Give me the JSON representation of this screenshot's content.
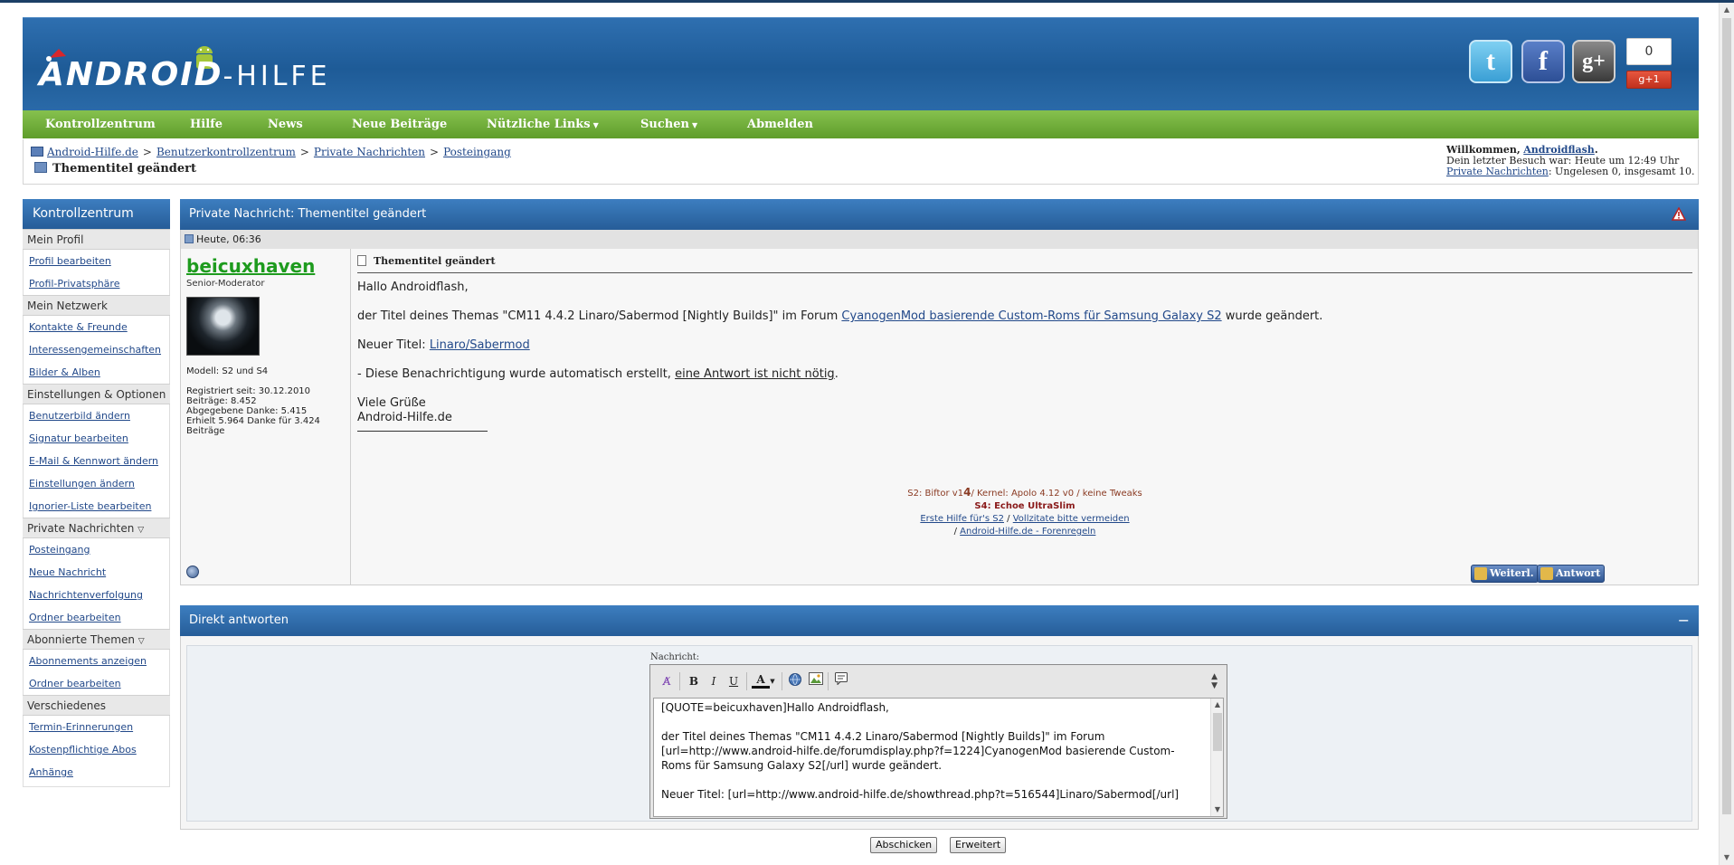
{
  "header": {
    "logo_main": "ANDROID",
    "logo_sub": "-HILFE",
    "gplus_count": "0",
    "gplus_label": "g+1"
  },
  "nav": {
    "items": [
      "Kontrollzentrum",
      "Hilfe",
      "News",
      "Neue Beiträge",
      "Nützliche Links",
      "Suchen",
      "Abmelden"
    ]
  },
  "breadcrumb": {
    "items": [
      "Android-Hilfe.de",
      "Benutzerkontrollzentrum",
      "Private Nachrichten",
      "Posteingang"
    ],
    "separator": ">",
    "current": "Thementitel geändert"
  },
  "welcome": {
    "prefix": "Willkommen,",
    "user": "Androidflash",
    "suffix": ".",
    "last_visit": "Dein letzter Besuch war: Heute um 12:49 Uhr",
    "pm_link": "Private Nachrichten",
    "pm_status": ": Ungelesen 0, insgesamt 10."
  },
  "sidebar": {
    "title": "Kontrollzentrum",
    "groups": [
      {
        "label": "Mein Profil",
        "links": [
          "Profil bearbeiten",
          "Profil-Privatsphäre"
        ]
      },
      {
        "label": "Mein Netzwerk",
        "links": [
          "Kontakte & Freunde",
          "Interessengemeinschaften",
          "Bilder & Alben"
        ]
      },
      {
        "label": "Einstellungen & Optionen",
        "links": [
          "Benutzerbild ändern",
          "Signatur bearbeiten",
          "E-Mail & Kennwort ändern",
          "Einstellungen ändern",
          "Ignorier-Liste bearbeiten"
        ]
      },
      {
        "label": "Private Nachrichten",
        "links": [
          "Posteingang",
          "Neue Nachricht",
          "Nachrichtenverfolgung",
          "Ordner bearbeiten"
        ]
      },
      {
        "label": "Abonnierte Themen",
        "links": [
          "Abonnements anzeigen",
          "Ordner bearbeiten"
        ]
      },
      {
        "label": "Verschiedenes",
        "links": [
          "Termin-Erinnerungen",
          "Kostenpflichtige Abos",
          "Anhänge"
        ]
      }
    ]
  },
  "message": {
    "panel_title": "Private Nachricht: Thementitel geändert",
    "date": "Heute, 06:36",
    "user": {
      "name": "beicuxhaven",
      "title": "Senior-Moderator",
      "model": "Modell: S2 und S4",
      "registered": "Registriert seit: 30.12.2010",
      "posts": "Beiträge: 8.452",
      "thanks_given": "Abgegebene Danke: 5.415",
      "thanks_received": "Erhielt 5.964 Danke für 3.424 Beiträge"
    },
    "title": "Thementitel geändert",
    "greeting": "Hallo Androidflash,",
    "line1_pre": "der Titel deines Themas \"CM11 4.4.2 Linaro/Sabermod [Nightly Builds]\" im Forum ",
    "line1_link": "CyanogenMod basierende Custom-Roms für Samsung Galaxy S2",
    "line1_post": " wurde geändert.",
    "line2_pre": "Neuer Titel: ",
    "line2_link": "Linaro/Sabermod",
    "line3_pre": "- Diese Benachrichtigung wurde automatisch erstellt, ",
    "line3_ul": "eine Antwort ist nicht nötig",
    "line3_post": ".",
    "closing1": "Viele Grüße",
    "closing2": "Android-Hilfe.de",
    "signature": {
      "s2_pre": "S2: Biftor v1",
      "s2_big": "4",
      "s2_post": "/ Kernel: Apolo 4.12 v0 / keine Tweaks",
      "s4": "S4: Echoe UltraSlim",
      "link1": "Erste Hilfe für's S2",
      "sep1": " / ",
      "link2": "Vollzitate bitte vermeiden",
      "sep2": "/ ",
      "link3": "Android-Hilfe.de - Forenregeln"
    },
    "forward_label": "Weiterl.",
    "reply_label": "Antwort"
  },
  "quick_reply": {
    "title": "Direkt antworten",
    "collapse": "−",
    "label": "Nachricht:",
    "text": "[QUOTE=beicuxhaven]Hallo Androidflash,\n\nder Titel deines Themas \"CM11 4.4.2 Linaro/Sabermod [Nightly Builds]\" im Forum [url=http://www.android-hilfe.de/forumdisplay.php?f=1224]CyanogenMod basierende Custom-Roms für Samsung Galaxy S2[/url] wurde geändert.\n\nNeuer Titel: [url=http://www.android-hilfe.de/showthread.php?t=516544]Linaro/Sabermod[/url]",
    "submit": "Abschicken",
    "advanced": "Erweitert"
  },
  "colors": {
    "header_blue": "#2e6fb0",
    "nav_green": "#6faf3a",
    "link": "#22498a",
    "username_green": "#1e9b1e"
  }
}
